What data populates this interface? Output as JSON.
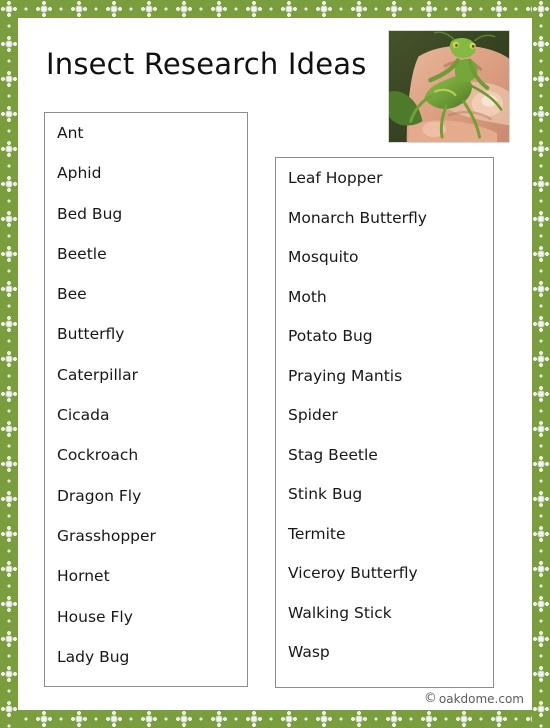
{
  "document": {
    "title": "Insect Research Ideas",
    "border_color": "#7a9d3e",
    "border_motif": "floral-rosette-band"
  },
  "photo": {
    "alt_name": "praying-mantis-on-hand-photo",
    "subject": "Praying mantis held on a human hand",
    "colors": {
      "mantis": "#6f9c3a",
      "skin": "#e0a98c",
      "background": "#3d4a27"
    }
  },
  "lists": [
    {
      "name": "insect-list-column-1",
      "items": [
        "Ant",
        "Aphid",
        "Bed Bug",
        "Beetle",
        "Bee",
        "Butterfly",
        "Caterpillar",
        "Cicada",
        "Cockroach",
        "Dragon Fly",
        "Grasshopper",
        "Hornet",
        "House Fly",
        "Lady Bug"
      ]
    },
    {
      "name": "insect-list-column-2",
      "items": [
        "Leaf Hopper",
        "Monarch Butterfly",
        "Mosquito",
        "Moth",
        "Potato Bug",
        "Praying Mantis",
        "Spider",
        "Stag Beetle",
        "Stink Bug",
        "Termite",
        "Viceroy Butterfly",
        "Walking Stick",
        "Wasp"
      ]
    }
  ],
  "watermark": {
    "symbol": "©",
    "text": "oakdome.com"
  }
}
